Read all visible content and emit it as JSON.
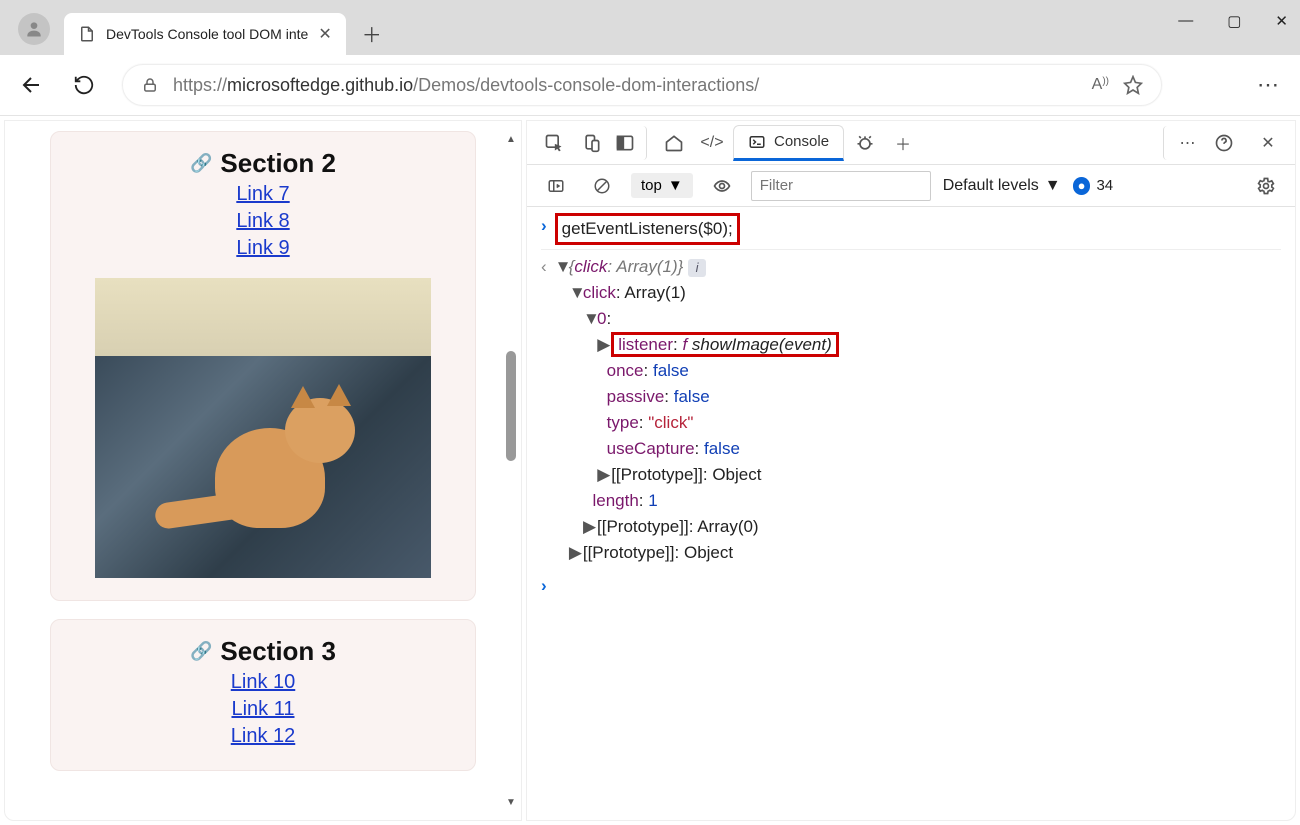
{
  "browser": {
    "tab_title": "DevTools Console tool DOM inte",
    "url_display_prefix": "https://",
    "url_host": "microsoftedge.github.io",
    "url_path": "/Demos/devtools-console-dom-interactions/"
  },
  "page": {
    "sections": [
      {
        "heading": "Section 2",
        "links": [
          "Link 7",
          "Link 8",
          "Link 9"
        ],
        "has_image": true
      },
      {
        "heading": "Section 3",
        "links": [
          "Link 10",
          "Link 11",
          "Link 12"
        ],
        "has_image": false
      }
    ]
  },
  "devtools": {
    "active_tab": "Console",
    "context": "top",
    "filter_placeholder": "Filter",
    "levels_label": "Default levels",
    "issues_count": "34",
    "input_expr": "getEventListeners($0);",
    "result": {
      "summary_key": "click",
      "summary_val": "Array(1)",
      "click_label": "click",
      "click_val": "Array(1)",
      "index": "0",
      "listener_key": "listener",
      "listener_fn": "showImage(event)",
      "props": [
        {
          "k": "once",
          "v": "false",
          "t": "bool"
        },
        {
          "k": "passive",
          "v": "false",
          "t": "bool"
        },
        {
          "k": "type",
          "v": "\"click\"",
          "t": "str"
        },
        {
          "k": "useCapture",
          "v": "false",
          "t": "bool"
        }
      ],
      "proto1": "[[Prototype]]",
      "proto1_val": "Object",
      "length_key": "length",
      "length_val": "1",
      "proto2": "[[Prototype]]",
      "proto2_val": "Array(0)",
      "proto3": "[[Prototype]]",
      "proto3_val": "Object"
    }
  }
}
